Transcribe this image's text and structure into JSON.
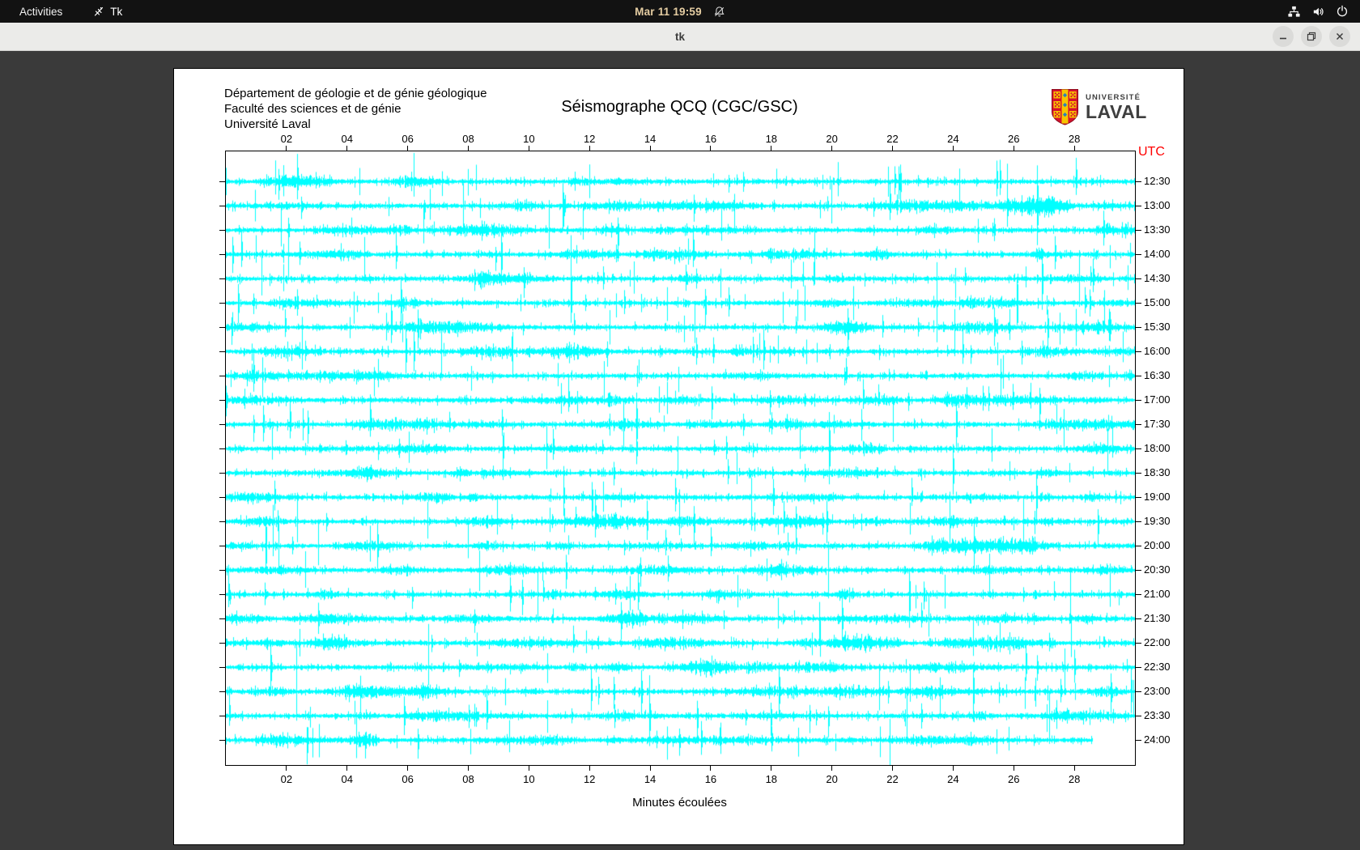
{
  "topbar": {
    "activities": "Activities",
    "app_label": "Tk",
    "clock": "Mar 11 19:59",
    "status_icons": [
      "network-icon",
      "volume-icon",
      "power-icon"
    ]
  },
  "titlebar": {
    "title": "tk",
    "buttons": [
      "minimize",
      "restore",
      "close"
    ]
  },
  "header": {
    "institution_lines": [
      "Département de géologie et de génie géologique",
      "Faculté des sciences et de génie",
      "Université Laval"
    ]
  },
  "logo": {
    "small": "UNIVERSITÉ",
    "large": "LAVAL",
    "shield_red": "#d6112e",
    "shield_gold": "#f6c500",
    "shield_blue": "#2a7fc1"
  },
  "chart_data": {
    "type": "line",
    "subtype": "helicorder-seismogram",
    "title": "Séismographe QCQ (CGC/GSC)",
    "xlabel": "Minutes écoulées",
    "x_ticks": [
      "02",
      "04",
      "06",
      "08",
      "10",
      "12",
      "14",
      "16",
      "18",
      "20",
      "22",
      "24",
      "26",
      "28"
    ],
    "x_range_minutes": [
      0,
      30
    ],
    "right_axis_label": "UTC",
    "right_axis_label_color": "#ff0000",
    "row_labels": [
      "12:30",
      "13:00",
      "13:30",
      "14:00",
      "14:30",
      "15:00",
      "15:30",
      "16:00",
      "16:30",
      "17:00",
      "17:30",
      "18:00",
      "18:30",
      "19:00",
      "19:30",
      "20:00",
      "20:30",
      "21:00",
      "21:30",
      "22:00",
      "22:30",
      "23:00",
      "23:30",
      "24:00"
    ],
    "trace_color": "#00ffff",
    "rows": 24,
    "minutes_per_row": 30,
    "last_trace_end_minute": 28.6,
    "description": "Stacked half-hour traces of continuous seismic noise with random spikes; final trace (24:00 UTC) still recording."
  }
}
